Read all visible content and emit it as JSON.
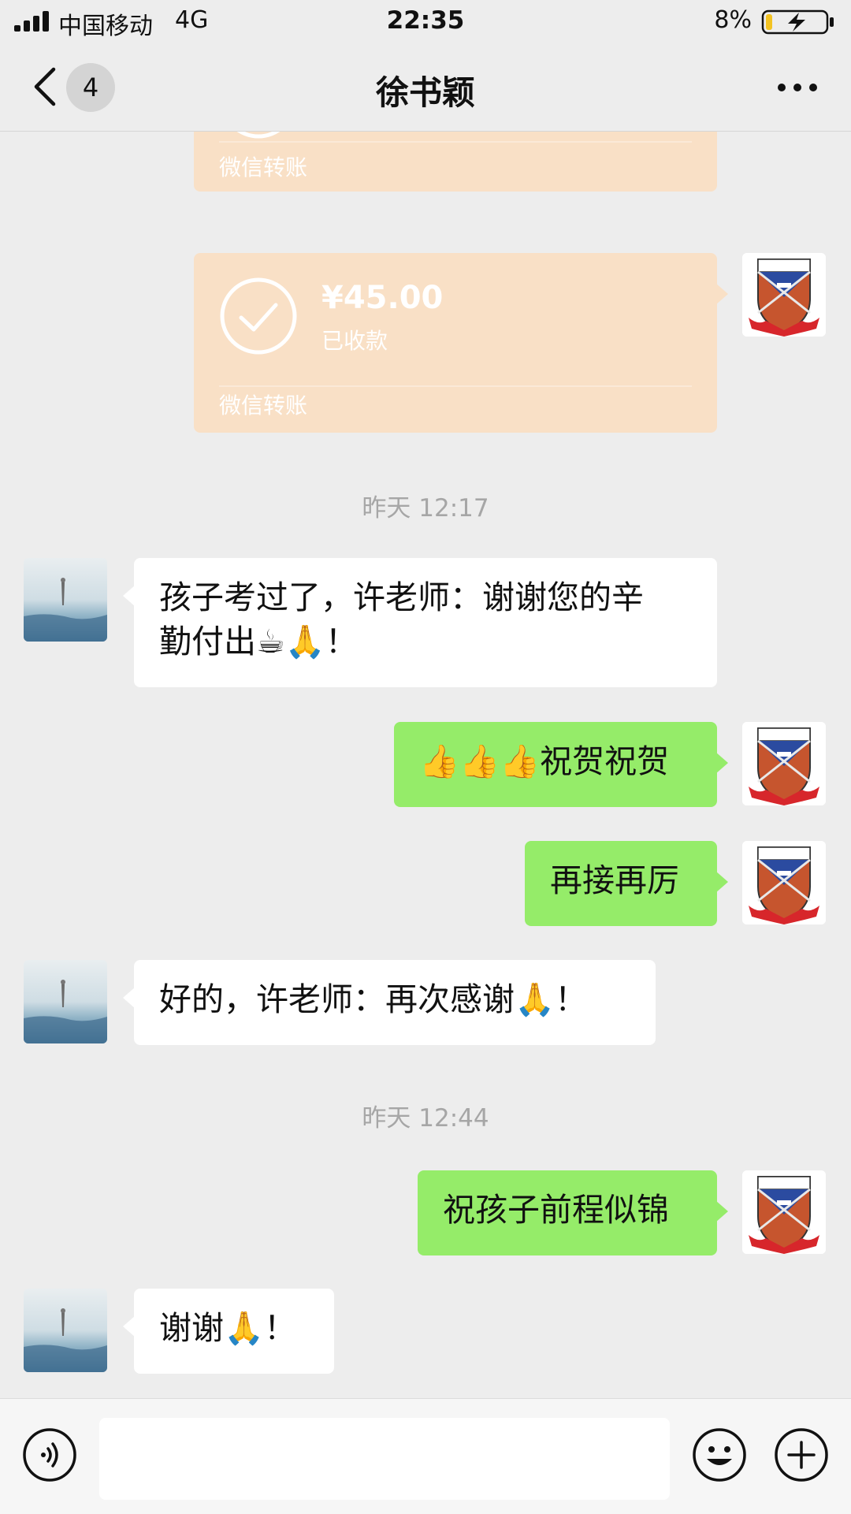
{
  "status_bar": {
    "carrier": "中国移动",
    "network": "4G",
    "time": "22:35",
    "battery": "8%"
  },
  "nav": {
    "unread_count": "4",
    "title": "徐书颖",
    "icons": [
      "back-icon",
      "more-icon"
    ]
  },
  "messages": {
    "transfer_partial": {
      "label": "微信转账"
    },
    "transfer_1": {
      "amount": "¥45.00",
      "status": "已收款",
      "label": "微信转账"
    },
    "timestamp_1": "昨天 12:17",
    "msg_1": "孩子考过了，许老师：谢谢您的辛\n勤付出☕🙏！",
    "msg_2": "👍👍👍祝贺祝贺",
    "msg_3": "再接再厉",
    "msg_4": "好的，许老师：再次感谢🙏！",
    "timestamp_2": "昨天 12:44",
    "msg_5": "祝孩子前程似锦",
    "msg_6": "谢谢🙏！"
  },
  "avatar_text": {
    "motto": "毅 天 行",
    "year": "2016",
    "ribbon": "YI TIAN XING"
  },
  "colors": {
    "background": "#ededed",
    "bubble_self": "#95ec69",
    "bubble_other": "#ffffff",
    "transfer": "#f9e0c6",
    "timestamp": "#a6a6a6"
  },
  "input_bar": {
    "icons": [
      "voice-icon",
      "emoji-icon",
      "plus-icon"
    ],
    "text_value": ""
  }
}
